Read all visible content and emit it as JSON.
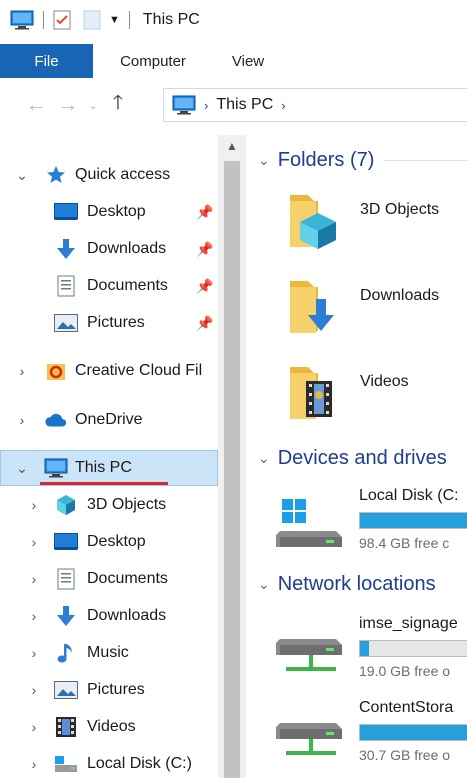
{
  "titlebar": {
    "title": "This PC",
    "icons": [
      "this-pc-icon",
      "properties-icon",
      "new-folder-icon",
      "customize-qat-icon"
    ]
  },
  "ribbon": {
    "tabs": [
      {
        "label": "File",
        "active": true
      },
      {
        "label": "Computer"
      },
      {
        "label": "View"
      }
    ]
  },
  "address": {
    "crumbs": [
      "This PC"
    ]
  },
  "nav": {
    "items": [
      {
        "label": "Quick access",
        "icon": "star-icon",
        "expanded": true
      },
      {
        "label": "Desktop",
        "icon": "desktop-icon",
        "pinned": true
      },
      {
        "label": "Downloads",
        "icon": "downloads-icon",
        "pinned": true
      },
      {
        "label": "Documents",
        "icon": "documents-icon",
        "pinned": true
      },
      {
        "label": "Pictures",
        "icon": "pictures-icon",
        "pinned": true
      },
      {
        "label": "Creative Cloud Fil",
        "icon": "creative-cloud-icon"
      },
      {
        "label": "OneDrive",
        "icon": "onedrive-icon"
      },
      {
        "label": "This PC",
        "icon": "this-pc-icon",
        "expanded": true,
        "selected": true
      },
      {
        "label": "3D Objects",
        "icon": "3d-objects-icon"
      },
      {
        "label": "Desktop",
        "icon": "desktop-icon"
      },
      {
        "label": "Documents",
        "icon": "documents-icon"
      },
      {
        "label": "Downloads",
        "icon": "downloads-icon"
      },
      {
        "label": "Music",
        "icon": "music-icon"
      },
      {
        "label": "Pictures",
        "icon": "pictures-icon"
      },
      {
        "label": "Videos",
        "icon": "videos-icon"
      },
      {
        "label": "Local Disk (C:)",
        "icon": "local-disk-icon"
      }
    ]
  },
  "content": {
    "folders_header": "Folders (7)",
    "folders": [
      {
        "name": "3D Objects",
        "icon": "3d-objects-folder-icon"
      },
      {
        "name": "Downloads",
        "icon": "downloads-folder-icon"
      },
      {
        "name": "Videos",
        "icon": "videos-folder-icon"
      }
    ],
    "devices_header": "Devices and drives",
    "drives": [
      {
        "name": "Local Disk (C:",
        "free": "98.4 GB free c",
        "used_fraction": 0.93,
        "icon": "windows-drive-icon"
      }
    ],
    "network_header": "Network locations",
    "network": [
      {
        "name": "imse_signage",
        "free": "19.0 GB free o",
        "used_fraction": 0.08,
        "icon": "network-drive-icon"
      },
      {
        "name": "ContentStora",
        "free": "30.7 GB free o",
        "used_fraction": 0.97,
        "icon": "network-drive-icon"
      }
    ]
  },
  "colors": {
    "accent": "#1a64b5",
    "selection": "#cce4f7",
    "group_header": "#1e3d8f",
    "progress": "#26a0da",
    "underline": "#e0242e"
  }
}
